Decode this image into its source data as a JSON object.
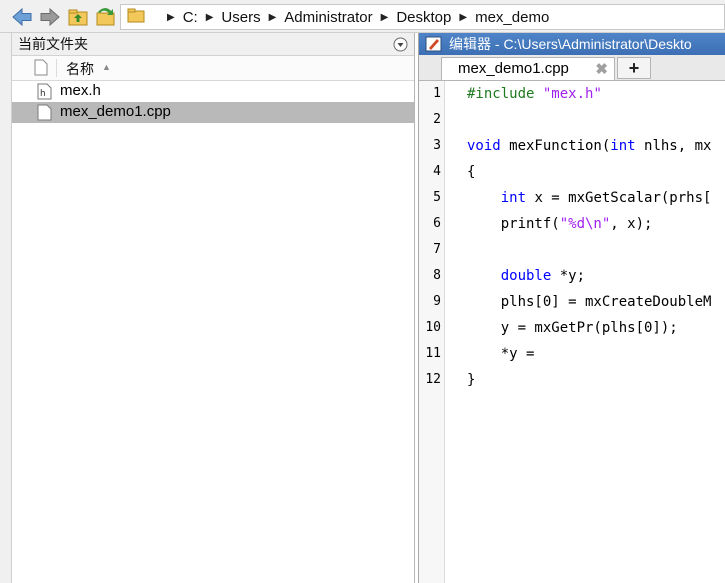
{
  "toolbar": {
    "back_icon": "back-arrow-icon",
    "forward_icon": "forward-arrow-icon",
    "up_icon": "folder-up-icon",
    "browse_icon": "browse-folder-icon"
  },
  "address": {
    "crumbs": [
      "C:",
      "Users",
      "Administrator",
      "Desktop",
      "mex_demo"
    ]
  },
  "current_folder": {
    "title": "当前文件夹",
    "column_name": "名称",
    "files": [
      {
        "name": "mex.h",
        "selected": false,
        "icon": "header-file-icon"
      },
      {
        "name": "mex_demo1.cpp",
        "selected": true,
        "icon": "file-icon"
      }
    ]
  },
  "editor": {
    "title": "编辑器 - C:\\Users\\Administrator\\Deskto",
    "tab_label": "mex_demo1.cpp",
    "tab_close": "✖",
    "tab_add": "+",
    "lines": [
      {
        "n": "1",
        "t": "#include \"mex.h\""
      },
      {
        "n": "2",
        "t": ""
      },
      {
        "n": "3",
        "t": "void mexFunction(int nlhs, mx"
      },
      {
        "n": "4",
        "t": "{"
      },
      {
        "n": "5",
        "t": "    int x = mxGetScalar(prhs["
      },
      {
        "n": "6",
        "t": "    printf(\"%d\\n\", x);"
      },
      {
        "n": "7",
        "t": ""
      },
      {
        "n": "8",
        "t": "    double *y;"
      },
      {
        "n": "9",
        "t": "    plhs[0] = mxCreateDoubleM"
      },
      {
        "n": "10",
        "t": "    y = mxGetPr(plhs[0]);"
      },
      {
        "n": "11",
        "t": "    *y ="
      },
      {
        "n": "12",
        "t": "}"
      }
    ]
  },
  "colors": {
    "keyword": "#0000ff",
    "string": "#a020f0",
    "title_bar": "#4478bd",
    "selection": "#b9b9b9"
  }
}
